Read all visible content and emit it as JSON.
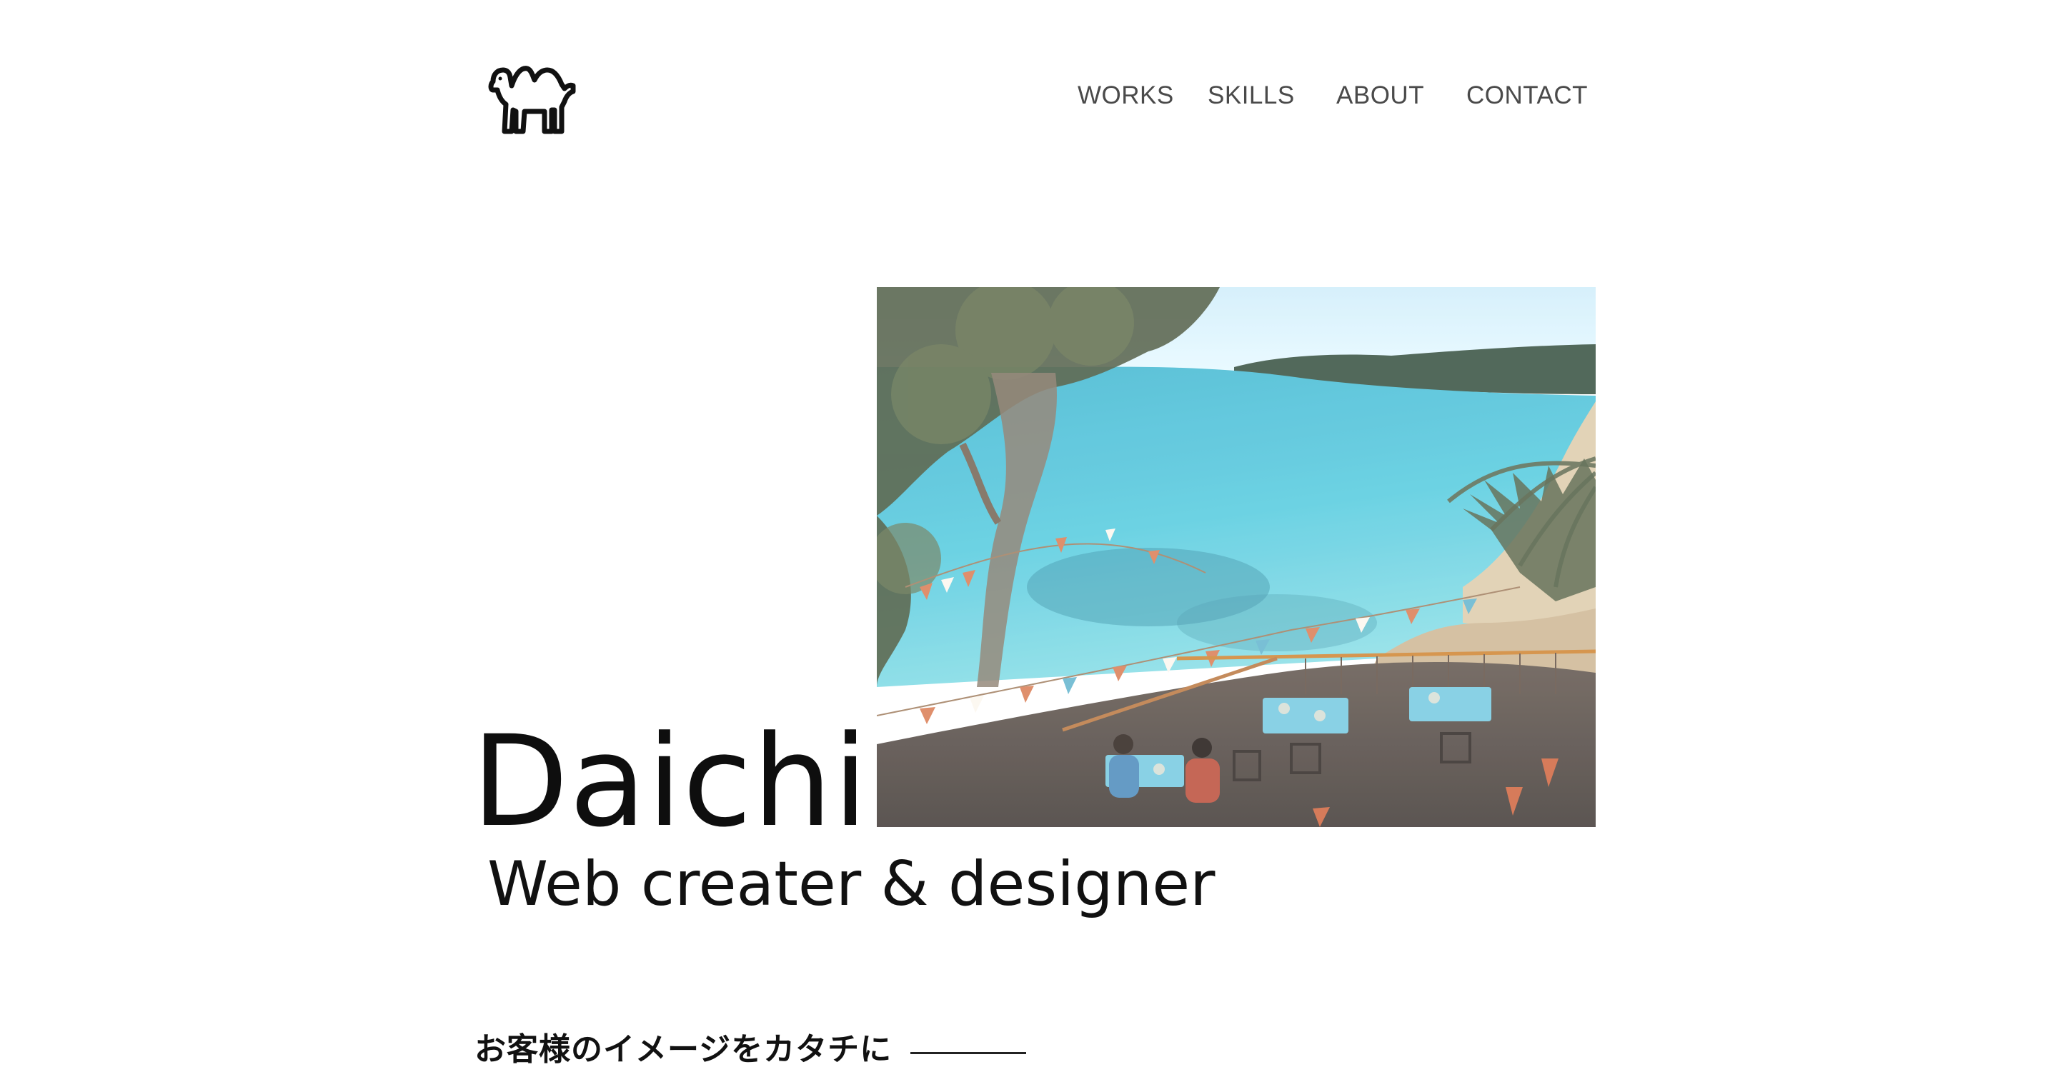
{
  "header": {
    "logo_icon": "camel-icon",
    "nav": [
      {
        "label": "WORKS"
      },
      {
        "label": "SKILLS"
      },
      {
        "label": "ABOUT"
      },
      {
        "label": "CONTACT"
      }
    ]
  },
  "hero": {
    "name": "Daichi",
    "tagline": "Web creater & designer",
    "photo_subject": "beach-cafe-photo"
  },
  "section": {
    "catchphrase": "お客様のイメージをカタチに"
  },
  "colors": {
    "background": "#ffffff",
    "text": "#111111",
    "nav_text": "#4a4a4a",
    "sea": "#4fc3d8",
    "sky": "#cfe9f5"
  }
}
